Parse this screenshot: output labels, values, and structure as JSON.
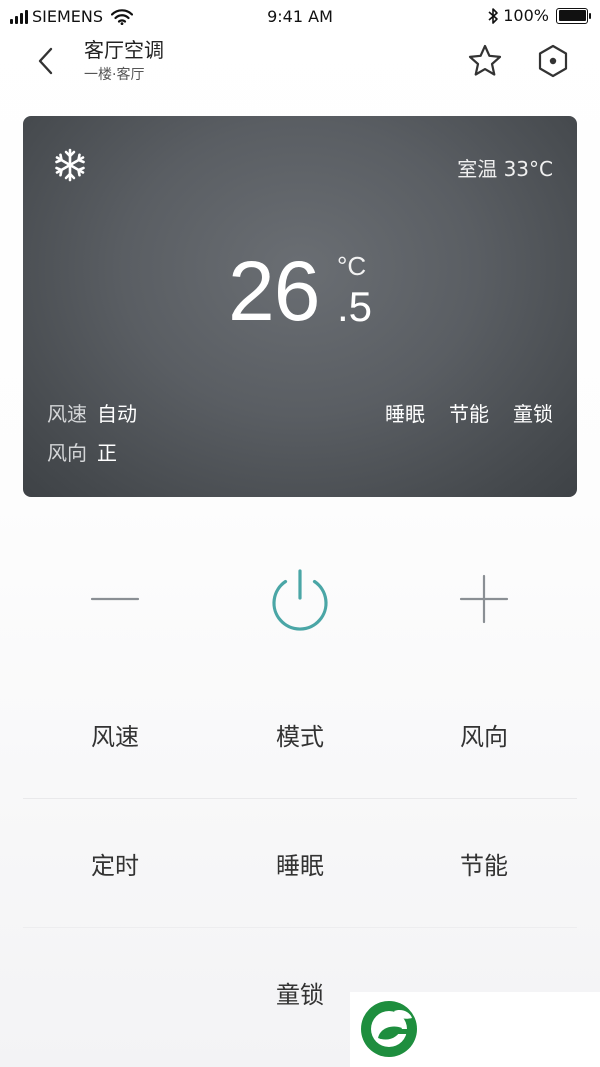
{
  "status_bar": {
    "carrier": "SIEMENS",
    "time": "9:41 AM",
    "battery": "100%",
    "battery_level": 1.0,
    "icons": [
      "signal-icon",
      "wifi-icon",
      "bluetooth-icon",
      "battery-icon"
    ]
  },
  "header": {
    "title": "客厅空调",
    "subtitle": "一楼·客厅",
    "icons": [
      "back-arrow-icon",
      "star-icon",
      "hexagon-settings-icon"
    ]
  },
  "card": {
    "mode_icon": "snowflake-icon",
    "room_temp": "室温 33°C",
    "set_temp_int": "26",
    "set_temp_unit": "°C",
    "set_temp_dec": ".5",
    "fan_speed_label": "风速",
    "fan_speed_value": "自动",
    "direction_label": "风向",
    "direction_value": "正",
    "features": [
      "睡眠",
      "节能",
      "童锁"
    ]
  },
  "controls": {
    "icons": [
      "minus-icon",
      "power-icon",
      "plus-icon"
    ],
    "power_color": "#4aa6a6"
  },
  "functions": {
    "row1": [
      "风速",
      "模式",
      "风向"
    ],
    "row2": [
      "定时",
      "睡眠",
      "节能"
    ],
    "row3": [
      "童锁"
    ]
  },
  "watermark": {
    "icon": "logo-leaf-icon",
    "color": "#1e8e3e"
  }
}
